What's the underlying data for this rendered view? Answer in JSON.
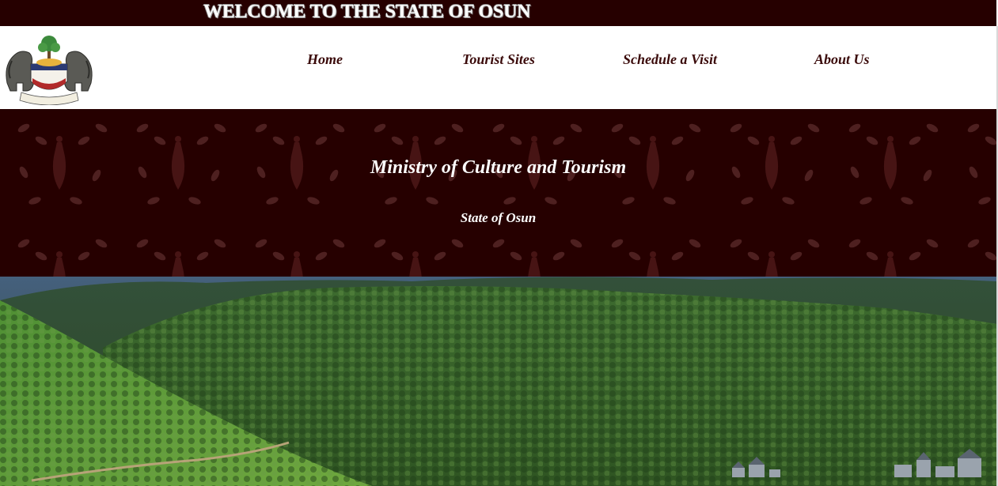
{
  "banner": {
    "title": "WELCOME TO THE STATE OF OSUN"
  },
  "nav": {
    "logo_name": "osun-state-coat-of-arms",
    "items": [
      {
        "label": "Home"
      },
      {
        "label": "Tourist Sites"
      },
      {
        "label": "Schedule a Visit"
      },
      {
        "label": "About Us"
      }
    ]
  },
  "hero": {
    "title": "Ministry of Culture and Tourism",
    "subtitle": "State of Osun"
  },
  "colors": {
    "maroon": "#260000",
    "nav_text": "#3a0a0a",
    "white": "#ffffff"
  }
}
